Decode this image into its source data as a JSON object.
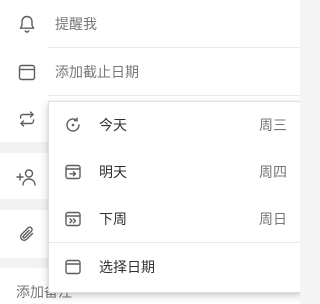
{
  "task_options": {
    "remind_label": "提醒我",
    "due_date_label": "添加截止日期",
    "add_note_label": "添加备注"
  },
  "due_menu": {
    "items": [
      {
        "label": "今天",
        "day": "周三",
        "icon": "calendar-today-icon"
      },
      {
        "label": "明天",
        "day": "周四",
        "icon": "calendar-tomorrow-icon"
      },
      {
        "label": "下周",
        "day": "周日",
        "icon": "calendar-next-week-icon"
      }
    ],
    "pick_date_label": "选择日期"
  },
  "colors": {
    "icon": "#605e5c",
    "text_muted": "#797775",
    "text_primary": "#323130"
  }
}
